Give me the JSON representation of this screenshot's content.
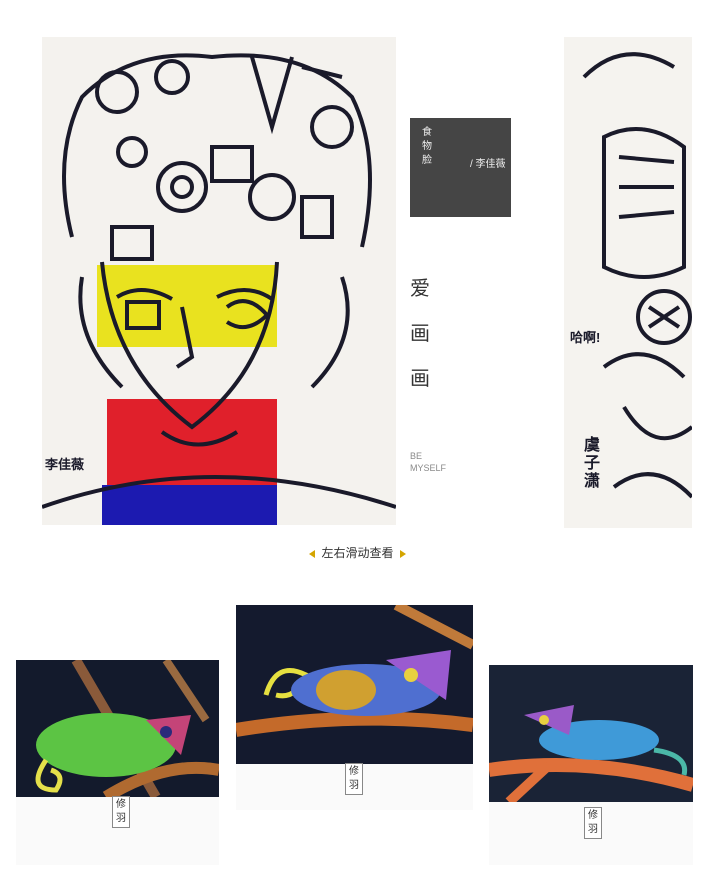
{
  "artwork1": {
    "title_chars": [
      "食",
      "物",
      "脸"
    ],
    "author": "/ 李佳薇",
    "signature": "李佳薇",
    "love_chars": [
      "爱",
      "画",
      "画"
    ],
    "be_myself_line1": "BE",
    "be_myself_line2": "MYSELF"
  },
  "artwork2": {
    "signature": "虞子潇",
    "exclaim": "哈啊!"
  },
  "swipe_hint": "左右滑动查看",
  "chameleons": [
    {
      "caption_chars": [
        "修",
        "羽"
      ]
    },
    {
      "caption_chars": [
        "修",
        "羽"
      ]
    },
    {
      "caption_chars": [
        "修",
        "羽"
      ]
    }
  ],
  "colors": {
    "title_box": "#454545",
    "arrow": "#d4a500",
    "yellow_band": "#e9e21f",
    "red_band": "#e0202b",
    "blue_band": "#1c1ab0"
  }
}
